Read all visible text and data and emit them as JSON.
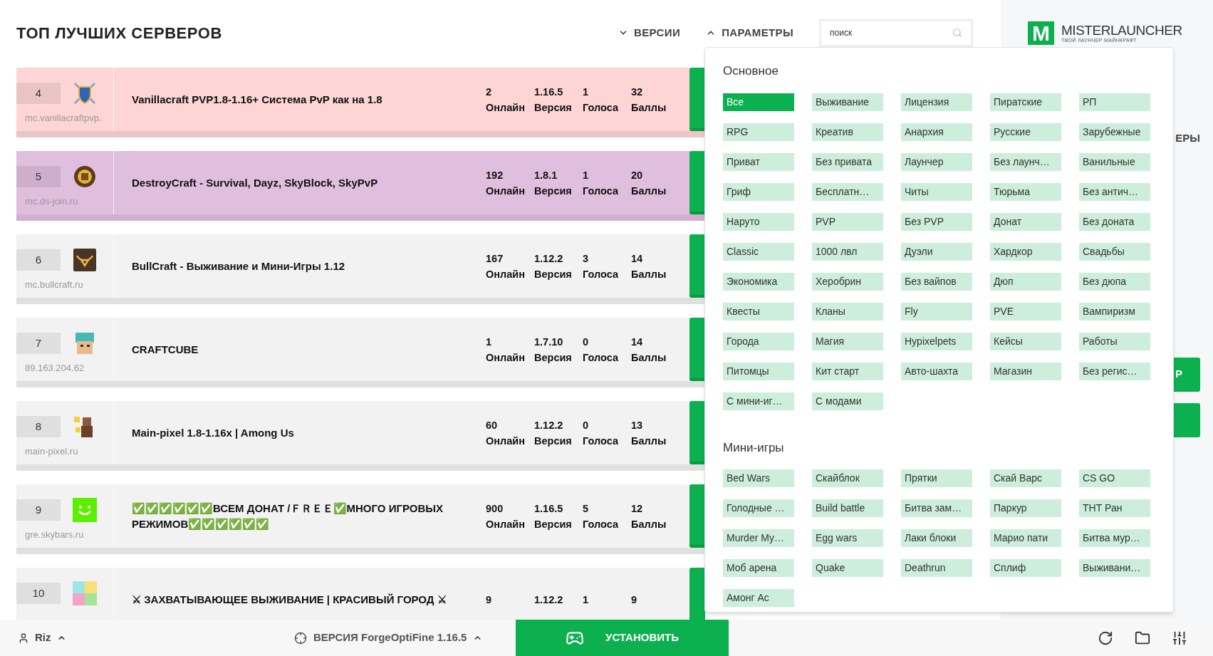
{
  "header": {
    "title": "ТОП ЛУЧШИХ СЕРВЕРОВ",
    "nav": [
      {
        "label": "ВЕРСИИ",
        "expanded": false
      },
      {
        "label": "ПАРАМЕТРЫ",
        "expanded": true
      }
    ],
    "search": {
      "placeholder": "поиск"
    }
  },
  "logo": {
    "letter": "M",
    "name": "MISTERLAUNCHER",
    "tagline": "ТВОЙ ЛАУНЧЕР МАЙНКРАФТ"
  },
  "servers": [
    {
      "rank": "4",
      "title": "Vanillacraft PVP1.8-1.16+ Система PvP как на 1.8",
      "address": "mc.vanillacraftpvp.",
      "color": "#fdd5d5",
      "stats": [
        {
          "value": "2",
          "label": "Онлайн"
        },
        {
          "value": "1.16.5",
          "label": "Версия"
        },
        {
          "value": "1",
          "label": "Голоса"
        },
        {
          "value": "32",
          "label": "Баллы"
        }
      ]
    },
    {
      "rank": "5",
      "title": "DestroyCraft - Survival, Dayz, SkyBlock, SkyPvP",
      "address": "mc.ds-join.ru",
      "color": "#e0bedd",
      "stats": [
        {
          "value": "192",
          "label": "Онлайн"
        },
        {
          "value": "1.8.1",
          "label": "Версия"
        },
        {
          "value": "1",
          "label": "Голоса"
        },
        {
          "value": "20",
          "label": "Баллы"
        }
      ]
    },
    {
      "rank": "6",
      "title": "BullCraft - Выживание и Мини-Игры 1.12",
      "address": "mc.bullcraft.ru",
      "color": "#f2f2f2",
      "stats": [
        {
          "value": "167",
          "label": "Онлайн"
        },
        {
          "value": "1.12.2",
          "label": "Версия"
        },
        {
          "value": "3",
          "label": "Голоса"
        },
        {
          "value": "14",
          "label": "Баллы"
        }
      ]
    },
    {
      "rank": "7",
      "title": "CRAFTCUBE",
      "address": "89.163.204.62",
      "color": "#f2f2f2",
      "stats": [
        {
          "value": "1",
          "label": "Онлайн"
        },
        {
          "value": "1.7.10",
          "label": "Версия"
        },
        {
          "value": "0",
          "label": "Голоса"
        },
        {
          "value": "14",
          "label": "Баллы"
        }
      ]
    },
    {
      "rank": "8",
      "title": "Main-pixel 1.8-1.16x | Among Us",
      "address": "main-pixel.ru",
      "color": "#f2f2f2",
      "stats": [
        {
          "value": "60",
          "label": "Онлайн"
        },
        {
          "value": "1.12.2",
          "label": "Версия"
        },
        {
          "value": "0",
          "label": "Голоса"
        },
        {
          "value": "13",
          "label": "Баллы"
        }
      ]
    },
    {
      "rank": "9",
      "title": "✅✅✅✅✅✅ВСЕМ ДОНАТ /ＦＲＥＥ✅МНОГО ИГРОВЫХ РЕЖИМОВ✅✅✅✅✅✅",
      "address": "gre.skybars.ru",
      "color": "#f2f2f2",
      "stats": [
        {
          "value": "900",
          "label": "Онлайн"
        },
        {
          "value": "1.16.5",
          "label": "Версия"
        },
        {
          "value": "5",
          "label": "Голоса"
        },
        {
          "value": "12",
          "label": "Баллы"
        }
      ]
    },
    {
      "rank": "10",
      "title": "⚔ ЗАХВАТЫВАЮЩЕЕ ВЫЖИВАНИЕ | КРАСИВЫЙ ГОРОД ⚔",
      "color": "#f2f2f2",
      "stats": [
        {
          "value": "9"
        },
        {
          "value": "1.12.2"
        },
        {
          "value": "1"
        },
        {
          "value": "9"
        }
      ]
    }
  ],
  "sidebar": {
    "heading": "ЕРЫ",
    "button": "Р"
  },
  "filters": {
    "sections": [
      {
        "title": "Основное",
        "chips": [
          {
            "label": "Все",
            "selected": true
          },
          {
            "label": "Выживание",
            "selected": false
          },
          {
            "label": "Лицензия",
            "selected": false
          },
          {
            "label": "Пиратские",
            "selected": false
          },
          {
            "label": "РП",
            "selected": false
          },
          {
            "label": "RPG",
            "selected": false
          },
          {
            "label": "Креатив",
            "selected": false
          },
          {
            "label": "Анархия",
            "selected": false
          },
          {
            "label": "Русские",
            "selected": false
          },
          {
            "label": "Зарубежные",
            "selected": false
          },
          {
            "label": "Приват",
            "selected": false
          },
          {
            "label": "Без привата",
            "selected": false
          },
          {
            "label": "Лаунчер",
            "selected": false
          },
          {
            "label": "Без лаунч…",
            "selected": false
          },
          {
            "label": "Ванильные",
            "selected": false
          },
          {
            "label": "Гриф",
            "selected": false
          },
          {
            "label": "Бесплатн…",
            "selected": false
          },
          {
            "label": "Читы",
            "selected": false
          },
          {
            "label": "Тюрьма",
            "selected": false
          },
          {
            "label": "Без антич…",
            "selected": false
          },
          {
            "label": "Наруто",
            "selected": false
          },
          {
            "label": "PVP",
            "selected": false
          },
          {
            "label": "Без PVP",
            "selected": false
          },
          {
            "label": "Донат",
            "selected": false
          },
          {
            "label": "Без доната",
            "selected": false
          },
          {
            "label": "Classic",
            "selected": false
          },
          {
            "label": "1000 лвл",
            "selected": false
          },
          {
            "label": "Дуэли",
            "selected": false
          },
          {
            "label": "Хардкор",
            "selected": false
          },
          {
            "label": "Свадьбы",
            "selected": false
          },
          {
            "label": "Экономика",
            "selected": false
          },
          {
            "label": "Херобрин",
            "selected": false
          },
          {
            "label": "Без вайпов",
            "selected": false
          },
          {
            "label": "Дюп",
            "selected": false
          },
          {
            "label": "Без дюпа",
            "selected": false
          },
          {
            "label": "Квесты",
            "selected": false
          },
          {
            "label": "Кланы",
            "selected": false
          },
          {
            "label": "Fly",
            "selected": false
          },
          {
            "label": "PVE",
            "selected": false
          },
          {
            "label": "Вампиризм",
            "selected": false
          },
          {
            "label": "Города",
            "selected": false
          },
          {
            "label": "Магия",
            "selected": false
          },
          {
            "label": "Hypixelpets",
            "selected": false
          },
          {
            "label": "Кейсы",
            "selected": false
          },
          {
            "label": "Работы",
            "selected": false
          },
          {
            "label": "Питомцы",
            "selected": false
          },
          {
            "label": "Кит старт",
            "selected": false
          },
          {
            "label": "Авто-шахта",
            "selected": false
          },
          {
            "label": "Магазин",
            "selected": false
          },
          {
            "label": "Без регис…",
            "selected": false
          },
          {
            "label": "С мини-иг…",
            "selected": false
          },
          {
            "label": "С модами",
            "selected": false
          }
        ]
      },
      {
        "title": "Мини-игры",
        "chips": [
          {
            "label": "Bed Wars",
            "selected": false
          },
          {
            "label": "Скайблок",
            "selected": false
          },
          {
            "label": "Прятки",
            "selected": false
          },
          {
            "label": "Скай Варс",
            "selected": false
          },
          {
            "label": "CS GO",
            "selected": false
          },
          {
            "label": "Голодные …",
            "selected": false
          },
          {
            "label": "Build battle",
            "selected": false
          },
          {
            "label": "Битва зам…",
            "selected": false
          },
          {
            "label": "Паркур",
            "selected": false
          },
          {
            "label": "ТНТ Ран",
            "selected": false
          },
          {
            "label": "Murder My…",
            "selected": false
          },
          {
            "label": "Egg wars",
            "selected": false
          },
          {
            "label": "Лаки блоки",
            "selected": false
          },
          {
            "label": "Марио пати",
            "selected": false
          },
          {
            "label": "Битва мур…",
            "selected": false
          },
          {
            "label": "Моб арена",
            "selected": false
          },
          {
            "label": "Quake",
            "selected": false
          },
          {
            "label": "Deathrun",
            "selected": false
          },
          {
            "label": "Сплиф",
            "selected": false
          },
          {
            "label": "Выживани…",
            "selected": false
          },
          {
            "label": "Амонг Ас",
            "selected": false
          }
        ]
      }
    ]
  },
  "bottom_bar": {
    "user": "Riz",
    "version": "ВЕРСИЯ ForgeOptiFine 1.16.5",
    "install": "УСТАНОВИТЬ"
  }
}
